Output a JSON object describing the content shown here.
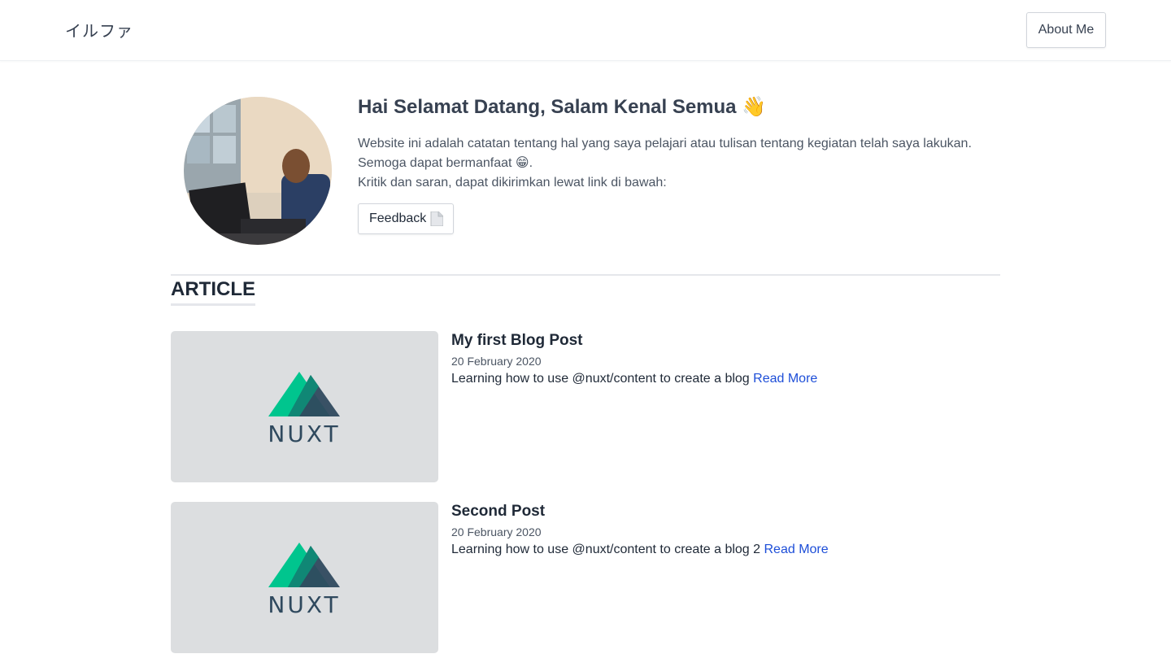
{
  "navbar": {
    "brand": "イルファ",
    "about_label": "About Me"
  },
  "hero": {
    "title": "Hai Selamat Datang, Salam Kenal Semua 👋",
    "line1": "Website ini adalah catatan tentang hal yang saya pelajari atau tulisan tentang kegiatan telah saya lakukan.",
    "line2": "Semoga dapat bermanfaat 😁.",
    "line3": "Kritik dan saran, dapat dikirimkan lewat link di bawah:",
    "feedback_label": "Feedback"
  },
  "articles_section": {
    "title": "ARTICLE",
    "items": [
      {
        "title": "My first Blog Post",
        "date": "20 February 2020",
        "description": "Learning how to use @nuxt/content to create a blog",
        "link_label": "Read More",
        "thumbnail_logo": "NUXT"
      },
      {
        "title": "Second Post",
        "date": "20 February 2020",
        "description": "Learning how to use @nuxt/content to create a blog 2",
        "link_label": "Read More",
        "thumbnail_logo": "NUXT"
      }
    ]
  },
  "colors": {
    "link": "#1d4ed8",
    "nuxt_green": "#00c58e",
    "nuxt_dark": "#2f495e",
    "thumb_bg": "#dcdee0"
  }
}
